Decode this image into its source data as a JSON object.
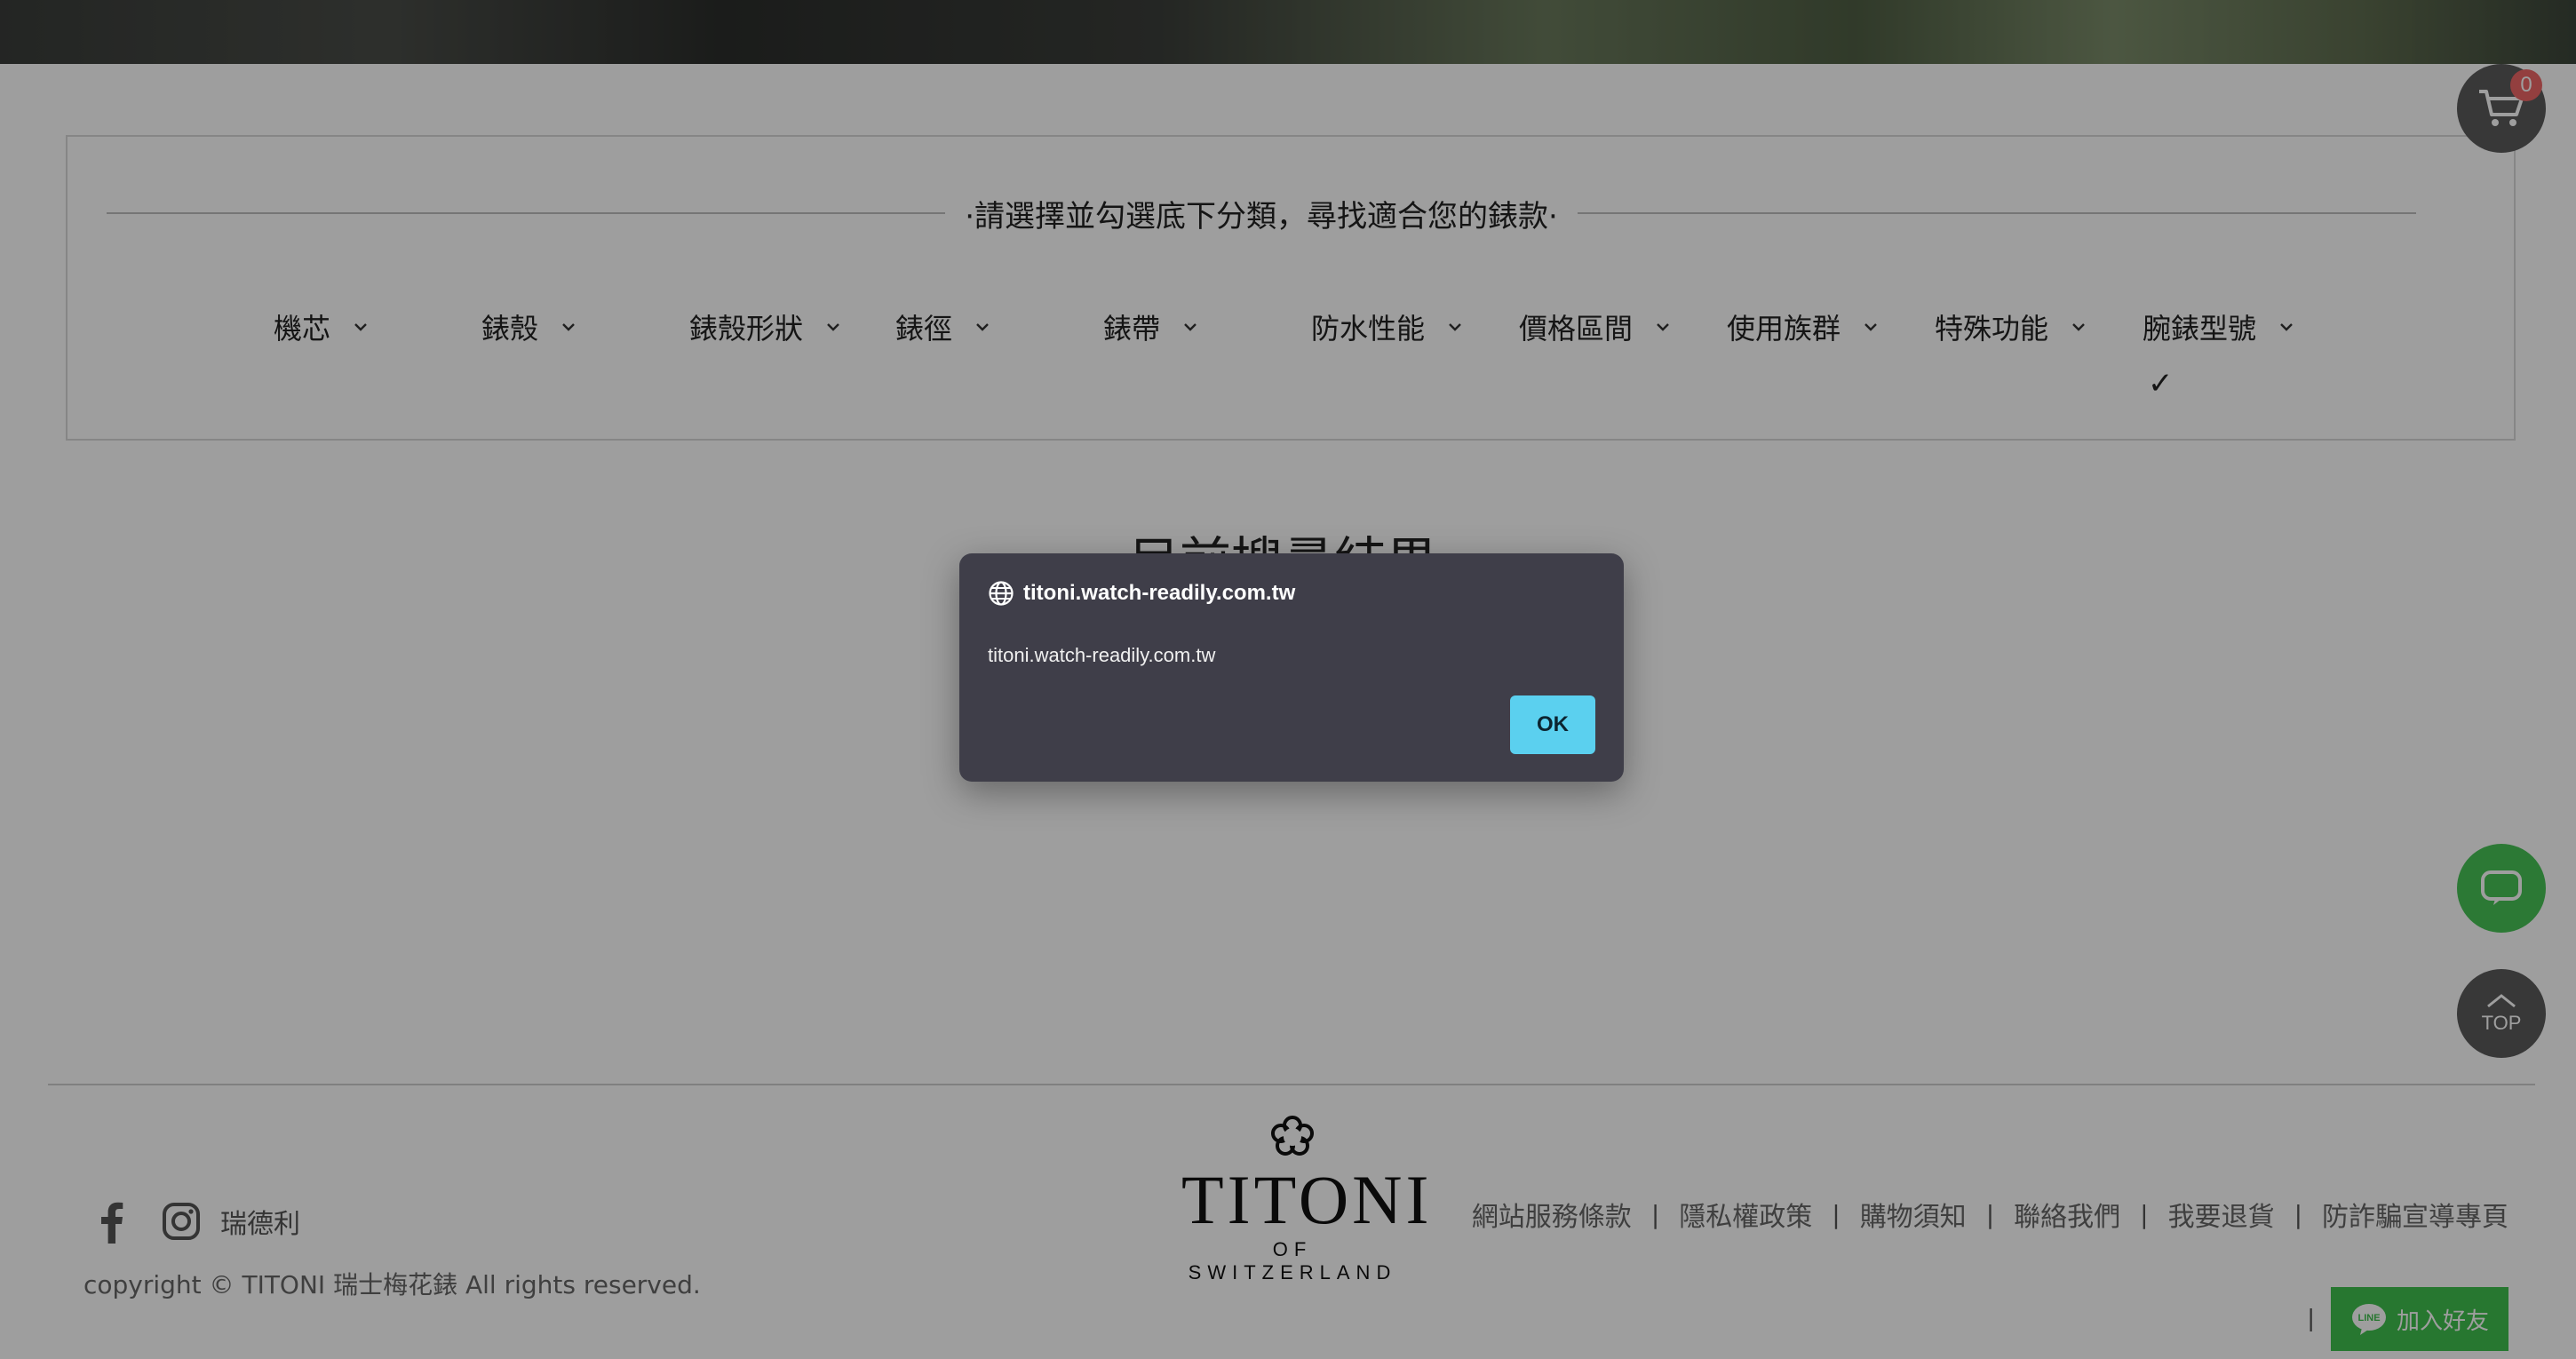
{
  "filter": {
    "title": "·請選擇並勾選底下分類，尋找適合您的錶款·",
    "categories": [
      "機芯",
      "錶殼",
      "錶殼形狀",
      "錶徑",
      "錶帶",
      "防水性能",
      "價格區間",
      "使用族群",
      "特殊功能",
      "腕錶型號"
    ],
    "checkmark": "✓"
  },
  "results": {
    "title": "目前搜尋結果"
  },
  "cart": {
    "count": "0"
  },
  "top_button": {
    "label": "TOP"
  },
  "footer": {
    "social_text": "瑞德利",
    "copyright": "copyright © TITONI 瑞士梅花錶 All rights reserved.",
    "logo_word": "TITONI",
    "logo_sub": "OF SWITZERLAND",
    "links": [
      "網站服務條款",
      "隱私權政策",
      "購物須知",
      "聯絡我們",
      "我要退貨",
      "防詐騙宣導專頁"
    ],
    "separator": "|",
    "line_add": "加入好友",
    "line_badge": "LINE"
  },
  "dialog": {
    "origin": "titoni.watch-readily.com.tw",
    "message": "titoni.watch-readily.com.tw",
    "ok_label": "OK"
  },
  "colors": {
    "line_green": "#3fc04e",
    "dialog_bg": "#3f3e49",
    "ok_button": "#5bd0ef",
    "cart_badge": "#e66666"
  }
}
